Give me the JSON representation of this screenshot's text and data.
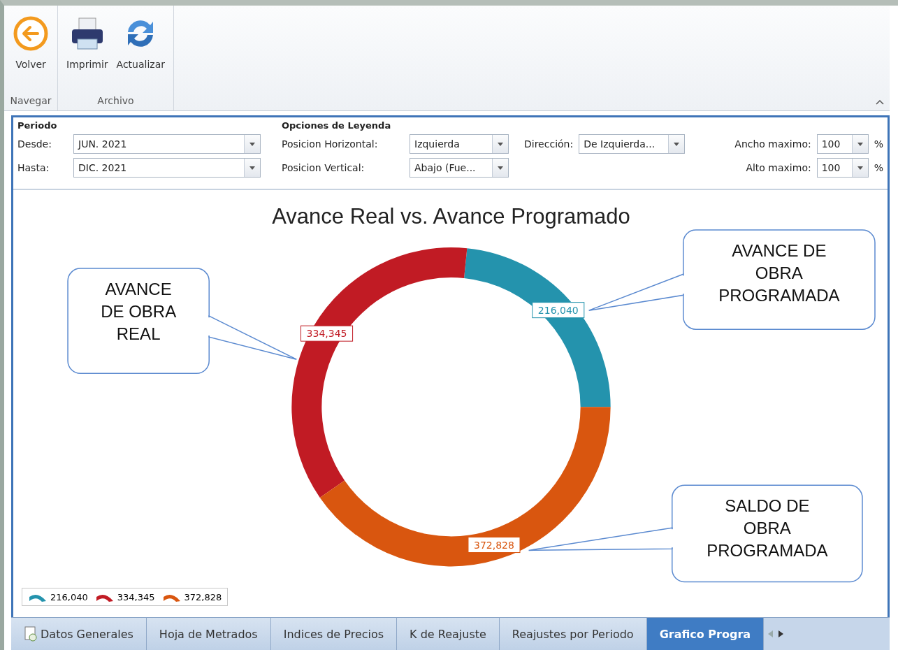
{
  "ribbon": {
    "groups": [
      {
        "label": "Navegar",
        "buttons": [
          {
            "kind": "back",
            "label": "Volver"
          }
        ]
      },
      {
        "label": "Archivo",
        "buttons": [
          {
            "kind": "print",
            "label": "Imprimir"
          },
          {
            "kind": "refresh",
            "label": "Actualizar"
          }
        ]
      }
    ]
  },
  "filters": {
    "periodo": {
      "title": "Periodo",
      "fields": [
        {
          "label": "Desde:",
          "value": "JUN. 2021"
        },
        {
          "label": "Hasta:",
          "value": "DIC. 2021"
        }
      ]
    },
    "leyenda": {
      "title": "Opciones de Leyenda",
      "horizontal": {
        "label": "Posicion Horizontal:",
        "value": "Izquierda"
      },
      "vertical": {
        "label": "Posicion Vertical:",
        "value": "Abajo (Fue..."
      },
      "direccion": {
        "label": "Dirección:",
        "value": "De Izquierda..."
      },
      "ancho": {
        "label": "Ancho maximo:",
        "value": "100",
        "unit": "%"
      },
      "alto": {
        "label": "Alto maximo:",
        "value": "100",
        "unit": "%"
      }
    }
  },
  "chart": {
    "chart_data": {
      "type": "donut",
      "title": "Avance Real vs. Avance Programado",
      "categories": [
        "216,040",
        "334,345",
        "372,828"
      ],
      "series": [
        {
          "color": "#2493ad",
          "values": [
            216040,
            334345,
            372828
          ]
        }
      ],
      "colors": [
        "#2493ad",
        "#c11b24",
        "#d9560f"
      ],
      "value_labels": [
        "216,040",
        "334,345",
        "372,828"
      ]
    },
    "callouts": [
      {
        "lines": [
          "AVANCE",
          "DE OBRA",
          "REAL"
        ]
      },
      {
        "lines": [
          "AVANCE DE",
          "OBRA",
          "PROGRAMADA"
        ]
      },
      {
        "lines": [
          "SALDO DE",
          "OBRA",
          "PROGRAMADA"
        ]
      }
    ]
  },
  "tabs": [
    {
      "kind": "icon",
      "label": "Datos Generales",
      "selected": false
    },
    {
      "kind": "plain",
      "label": "Hoja de Metrados",
      "selected": false
    },
    {
      "kind": "plain",
      "label": "Indices de Precios",
      "selected": false
    },
    {
      "kind": "plain",
      "label": "K de Reajuste",
      "selected": false
    },
    {
      "kind": "plain",
      "label": "Reajustes por Periodo",
      "selected": false
    },
    {
      "kind": "plain",
      "label": "Grafico Progra",
      "selected": true
    }
  ]
}
